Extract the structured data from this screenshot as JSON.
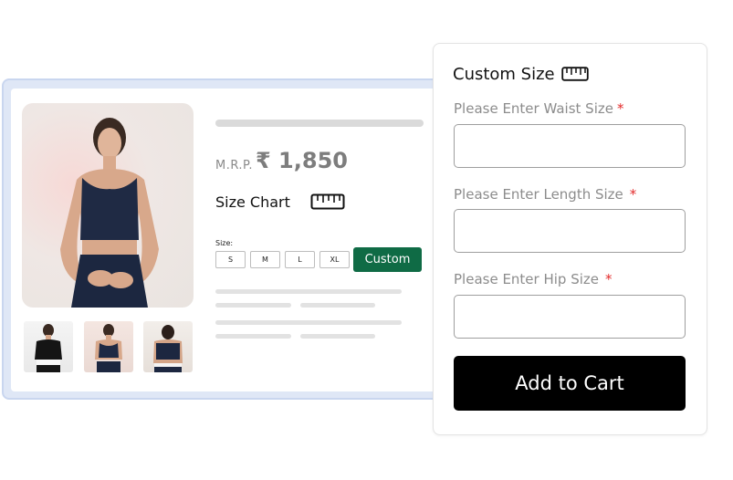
{
  "product": {
    "mrp_label": "M.R.P.",
    "price": "₹ 1,850",
    "size_chart_label": "Size Chart",
    "size_label": "Size:",
    "sizes": [
      "S",
      "M",
      "L",
      "XL"
    ],
    "custom_label": "Custom",
    "custom_color": "#0f6b45",
    "images": [
      "main-photo",
      "thumb-front",
      "thumb-side",
      "thumb-back"
    ]
  },
  "custom_size": {
    "title": "Custom Size",
    "fields": [
      {
        "label": "Please Enter Waist Size",
        "required_mark": "*",
        "value": "",
        "placeholder": ""
      },
      {
        "label": "Please Enter Length Size",
        "required_mark": "*",
        "value": "",
        "placeholder": ""
      },
      {
        "label": "Please Enter Hip Size",
        "required_mark": "*",
        "value": "",
        "placeholder": ""
      }
    ],
    "submit_label": "Add to Cart"
  },
  "icons": {
    "size_chart_icon": "ruler-icon",
    "panel_icon": "ruler-icon"
  }
}
